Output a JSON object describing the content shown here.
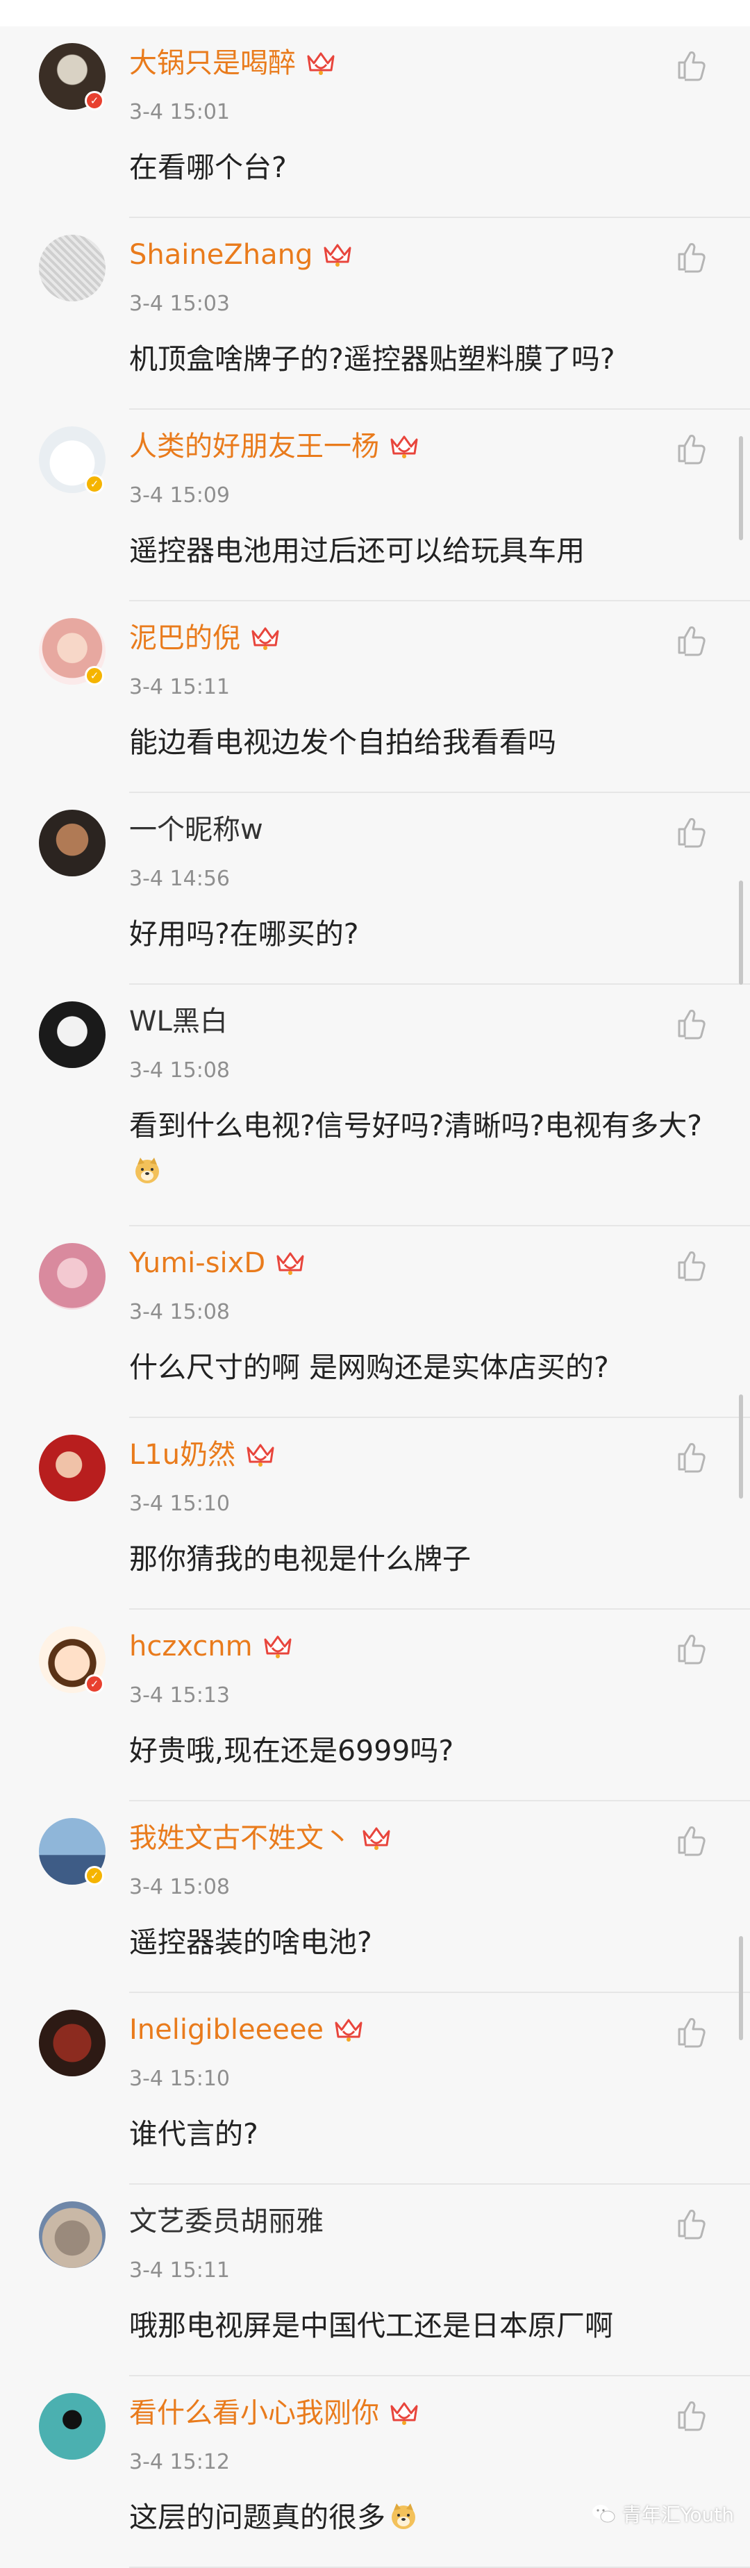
{
  "colors": {
    "vip_name": "#e97b1c",
    "plain_name": "#333333",
    "time": "#8f8f8f",
    "text": "#222222",
    "verified_yellow": "#f5b400",
    "verified_red": "#e8402f"
  },
  "comments": [
    {
      "name": "大锅只是喝醉",
      "vip": true,
      "badge": "red",
      "time": "3-4 15:01",
      "text": "在看哪个台?",
      "avatar_icon": "dog-avatar"
    },
    {
      "name": "ShaineZhang",
      "vip": true,
      "badge": "",
      "time": "3-4 15:03",
      "text": "机顶盒啥牌子的?遥控器贴塑料膜了吗?",
      "avatar_icon": "sketch-avatar"
    },
    {
      "name": "人类的好朋友王一杨",
      "vip": true,
      "badge": "yellow",
      "time": "3-4 15:09",
      "text": "遥控器电池用过后还可以给玩具车用",
      "avatar_icon": "bear-avatar"
    },
    {
      "name": "泥巴的倪",
      "vip": true,
      "badge": "yellow",
      "time": "3-4 15:11",
      "text": "能边看电视边发个自拍给我看看吗",
      "avatar_icon": "girl-avatar"
    },
    {
      "name": "一个昵称w",
      "vip": false,
      "badge": "",
      "time": "3-4 14:56",
      "text": "好用吗?在哪买的?",
      "avatar_icon": "portrait-avatar"
    },
    {
      "name": "WL黑白",
      "vip": false,
      "badge": "",
      "time": "3-4 15:08",
      "text": "看到什么电视?信号好吗?清晰吗?电视有多大?",
      "emoji": "doge-emoji",
      "avatar_icon": "anime-avatar"
    },
    {
      "name": "Yumi-sixD",
      "vip": true,
      "badge": "",
      "time": "3-4 15:08",
      "text": "什么尺寸的啊 是网购还是实体店买的?",
      "avatar_icon": "pink-avatar"
    },
    {
      "name": "L1u奶然",
      "vip": true,
      "badge": "",
      "time": "3-4 15:10",
      "text": "那你猜我的电视是什么牌子",
      "avatar_icon": "red-avatar"
    },
    {
      "name": "hczxcnm",
      "vip": true,
      "badge": "red",
      "time": "3-4 15:13",
      "text": "好贵哦,现在还是6999吗?",
      "avatar_icon": "cartoon-avatar"
    },
    {
      "name": "我姓文古不姓文丶",
      "vip": true,
      "badge": "yellow",
      "time": "3-4 15:08",
      "text": "遥控器装的啥电池?",
      "avatar_icon": "stage-avatar"
    },
    {
      "name": "Ineligibleeeee",
      "vip": true,
      "badge": "",
      "time": "3-4 15:10",
      "text": "谁代言的?",
      "avatar_icon": "group-avatar"
    },
    {
      "name": "文艺委员胡丽雅",
      "vip": false,
      "badge": "",
      "time": "3-4 15:11",
      "text": "哦那电视屏是中国代工还是日本原厂啊",
      "avatar_icon": "cat-avatar"
    },
    {
      "name": "看什么看小心我刚你",
      "vip": true,
      "badge": "",
      "time": "3-4 15:12",
      "text": "这层的问题真的很多",
      "emoji": "doge-emoji",
      "avatar_icon": "stamp-avatar"
    }
  ],
  "watermark": {
    "text": "青年汇Youth",
    "icon": "wechat-icon"
  }
}
